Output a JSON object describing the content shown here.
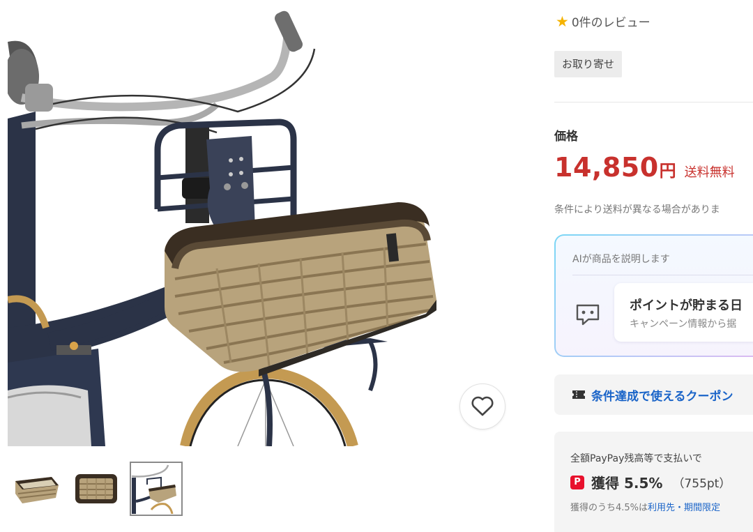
{
  "review": {
    "star_icon": "★",
    "text": "0件のレビュー"
  },
  "badge": {
    "label": "お取り寄せ"
  },
  "price": {
    "label": "価格",
    "amount": "14,850",
    "currency": "円",
    "shipping": "送料無料",
    "note": "条件により送料が異なる場合がありま"
  },
  "ai": {
    "label": "AIが商品を説明します",
    "card_title": "ポイントが貯まる日",
    "card_sub": "キャンペーン情報から据"
  },
  "coupon": {
    "text": "条件達成で使えるクーポン"
  },
  "pay": {
    "title": "全額PayPay残高等で支払いで",
    "icon_text": "P",
    "earn": "獲得 5.5%",
    "points": "（755pt）",
    "note_prefix": "獲得のうち4.5%は",
    "note_link": "利用先・期間限定"
  },
  "thumbnails": [
    {
      "name": "basket-angle-view",
      "selected": false
    },
    {
      "name": "basket-top-view",
      "selected": false
    },
    {
      "name": "basket-on-bicycle",
      "selected": true
    }
  ],
  "colors": {
    "price_red": "#c8312d",
    "link_blue": "#1a64c8",
    "star_yellow": "#f5b301",
    "paypay_red": "#e8112d",
    "bike_frame": "#2b3347",
    "wicker": "#b8a37c"
  }
}
